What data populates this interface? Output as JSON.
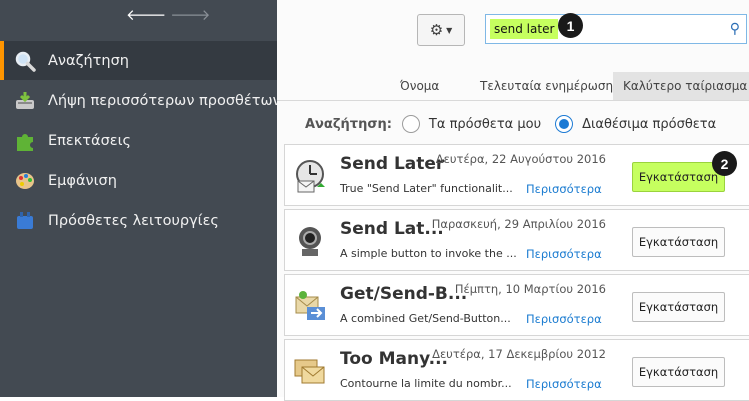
{
  "sidebar": {
    "items": [
      {
        "label": "Αναζήτηση",
        "icon": "magnifier-icon",
        "active": true
      },
      {
        "label": "Λήψη περισσότερων προσθέτων",
        "icon": "download-icon"
      },
      {
        "label": "Επεκτάσεις",
        "icon": "puzzle-icon"
      },
      {
        "label": "Εμφάνιση",
        "icon": "palette-icon"
      },
      {
        "label": "Πρόσθετες λειτουργίες",
        "icon": "plugin-icon"
      }
    ]
  },
  "toolbar": {
    "gear_icon": "gear-icon",
    "search_value": "send later",
    "search_highlight_color": "#c6ff5f"
  },
  "badges": {
    "one": "1",
    "two": "2"
  },
  "sort": {
    "name": "Όνομα",
    "last_updated": "Τελευταία ενημέρωση",
    "best_match": "Καλύτερο ταίριασμα"
  },
  "filter": {
    "label": "Αναζήτηση:",
    "my_addons": "Τα πρόσθετα μου",
    "available_addons": "Διαθέσιμα πρόσθετα"
  },
  "results": [
    {
      "name": "Send Later",
      "date": "Δευτέρα, 22 Αυγούστου 2016",
      "description": "True \"Send Later\" functionalit...",
      "more": "Περισσότερα",
      "install": "Εγκατάσταση",
      "highlighted": true
    },
    {
      "name": "Send Lat...",
      "date": "Παρασκευή, 29 Απριλίου 2016",
      "description": "A simple button to invoke the ...",
      "more": "Περισσότερα",
      "install": "Εγκατάσταση"
    },
    {
      "name": "Get/Send-B...",
      "date": "Πέμπτη, 10 Μαρτίου 2016",
      "description": "A combined Get/Send-Button...",
      "more": "Περισσότερα",
      "install": "Εγκατάσταση"
    },
    {
      "name": "Too Many...",
      "date": "Δευτέρα, 17 Δεκεμβρίου 2012",
      "description": "Contourne la limite du nombr...",
      "more": "Περισσότερα",
      "install": "Εγκατάσταση"
    }
  ]
}
